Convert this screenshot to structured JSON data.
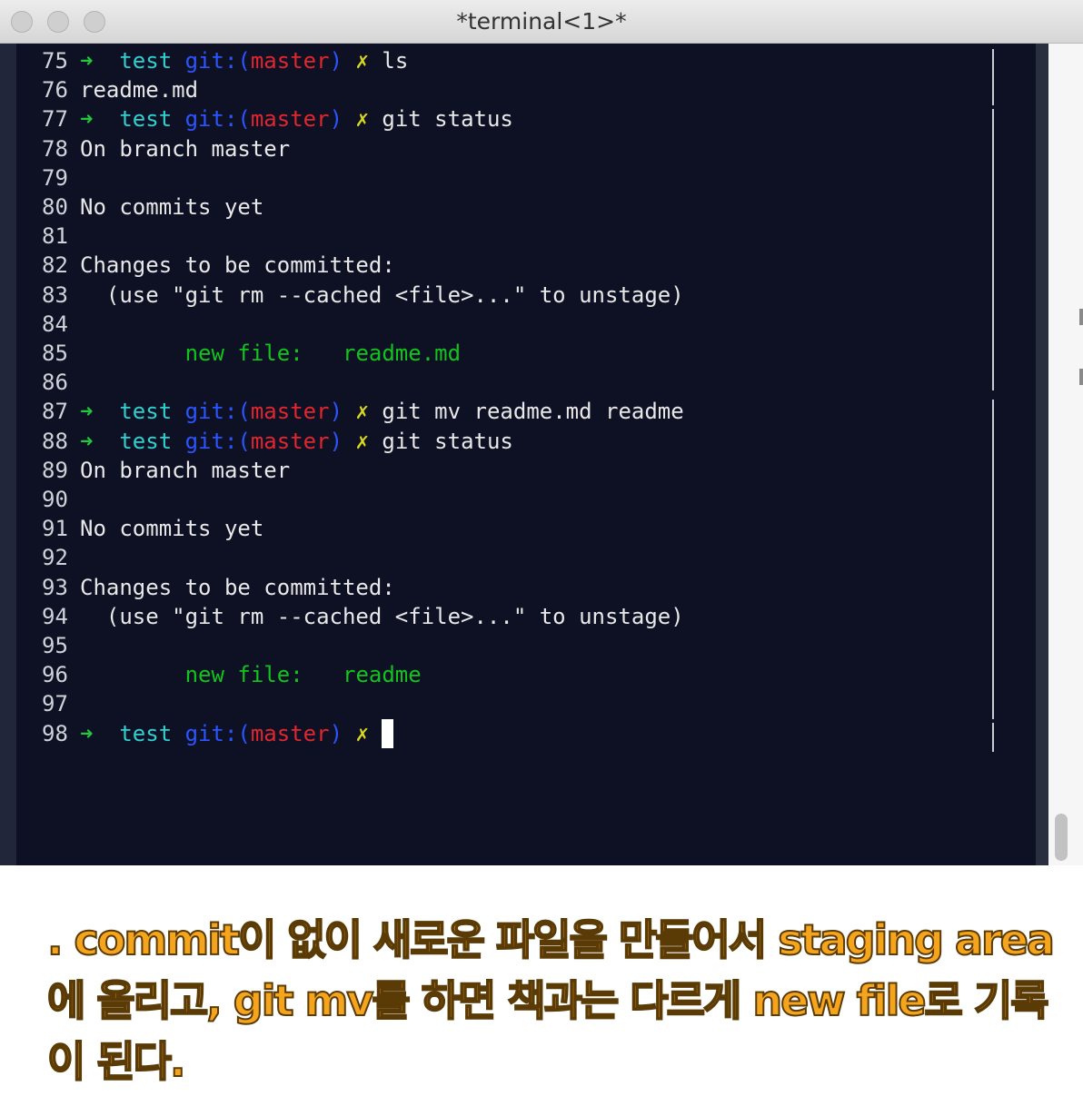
{
  "window": {
    "title": "*terminal<1>*"
  },
  "terminal": {
    "lines": [
      {
        "num": "75",
        "type": "prompt",
        "dir": "test",
        "git_prefix": "git:(",
        "branch": "master",
        "git_suffix": ")",
        "dirty": "✗",
        "command": "ls"
      },
      {
        "num": "76",
        "type": "text",
        "text": "readme.md"
      },
      {
        "num": "77",
        "type": "prompt",
        "dir": "test",
        "git_prefix": "git:(",
        "branch": "master",
        "git_suffix": ")",
        "dirty": "✗",
        "command": "git status"
      },
      {
        "num": "78",
        "type": "text",
        "text": "On branch master"
      },
      {
        "num": "79",
        "type": "text",
        "text": ""
      },
      {
        "num": "80",
        "type": "text",
        "text": "No commits yet"
      },
      {
        "num": "81",
        "type": "text",
        "text": ""
      },
      {
        "num": "82",
        "type": "text",
        "text": "Changes to be committed:"
      },
      {
        "num": "83",
        "type": "text",
        "text": "  (use \"git rm --cached <file>...\" to unstage)"
      },
      {
        "num": "84",
        "type": "text",
        "text": ""
      },
      {
        "num": "85",
        "type": "newfile",
        "indent": "        ",
        "label": "new file:",
        "file": "readme.md"
      },
      {
        "num": "86",
        "type": "text",
        "text": ""
      },
      {
        "num": "87",
        "type": "prompt",
        "dir": "test",
        "git_prefix": "git:(",
        "branch": "master",
        "git_suffix": ")",
        "dirty": "✗",
        "command": "git mv readme.md readme"
      },
      {
        "num": "88",
        "type": "prompt",
        "dir": "test",
        "git_prefix": "git:(",
        "branch": "master",
        "git_suffix": ")",
        "dirty": "✗",
        "command": "git status"
      },
      {
        "num": "89",
        "type": "text",
        "text": "On branch master"
      },
      {
        "num": "90",
        "type": "text",
        "text": ""
      },
      {
        "num": "91",
        "type": "text",
        "text": "No commits yet"
      },
      {
        "num": "92",
        "type": "text",
        "text": ""
      },
      {
        "num": "93",
        "type": "text",
        "text": "Changes to be committed:"
      },
      {
        "num": "94",
        "type": "text",
        "text": "  (use \"git rm --cached <file>...\" to unstage)"
      },
      {
        "num": "95",
        "type": "text",
        "text": ""
      },
      {
        "num": "96",
        "type": "newfile",
        "indent": "        ",
        "label": "new file:",
        "file": "readme"
      },
      {
        "num": "97",
        "type": "text",
        "text": ""
      },
      {
        "num": "98",
        "type": "prompt",
        "dir": "test",
        "git_prefix": "git:(",
        "branch": "master",
        "git_suffix": ")",
        "dirty": "✗",
        "command": "",
        "cursor": true
      }
    ],
    "arrow_glyph": "➜",
    "colors": {
      "background": "#0e1124",
      "arrow": "#22c83a",
      "dir": "#2fd0cf",
      "git": "#2a55ff",
      "branch": "#e0262e",
      "dirty": "#d8d81f",
      "new_file": "#13c31d"
    }
  },
  "caption": {
    "lines": [
      ". commit이 없이 새로운 파일을 만들어서 staging area",
      "에 올리고, git mv를 하면 책과는 다르게 new file로 기록",
      "이 된다."
    ],
    "color": "#f5a51d"
  }
}
